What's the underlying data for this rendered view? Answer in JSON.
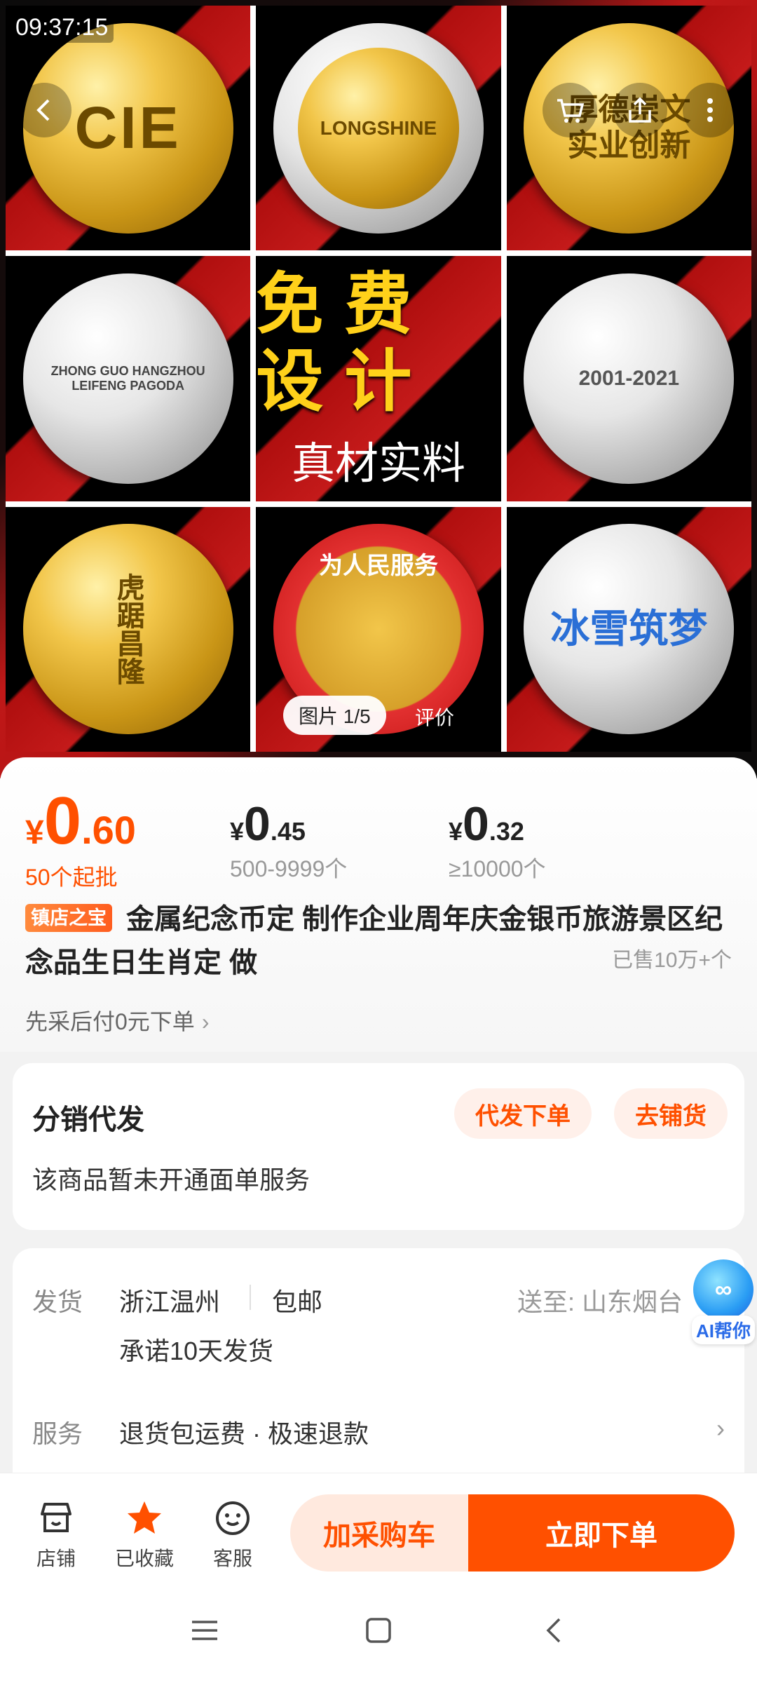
{
  "status_bar": {
    "time": "09:37:15"
  },
  "hero": {
    "back_icon": "chevron-left-icon",
    "cart_icon": "cart-icon",
    "share_icon": "share-icon",
    "more_icon": "more-dots-icon",
    "cells": [
      {
        "style": "gold",
        "text": "CIE"
      },
      {
        "style": "silver",
        "text": "LONGSHINE"
      },
      {
        "style": "gold",
        "text": "厚德崇文\n实业创新"
      },
      {
        "style": "silver",
        "text": "ZHONG GUO HANGZHOU LEIFENG PAGODA"
      },
      {
        "style": "center",
        "big": "免费设计",
        "sub": "真材实料"
      },
      {
        "style": "silver",
        "text": "2001-2021"
      },
      {
        "style": "gold",
        "text": "虎踞昌隆"
      },
      {
        "style": "red",
        "text": "为人民服务"
      },
      {
        "style": "silver",
        "text": "冰雪筑梦"
      }
    ],
    "image_index": "图片 1/5",
    "review_label": "评价"
  },
  "pricing": {
    "tiers": [
      {
        "currency": "¥",
        "int": "0",
        "dec": ".60",
        "qty": "50个起批"
      },
      {
        "currency": "¥",
        "int": "0",
        "dec": ".45",
        "qty": "500-9999个"
      },
      {
        "currency": "¥",
        "int": "0",
        "dec": ".32",
        "qty": "≥10000个"
      }
    ]
  },
  "product": {
    "badge": "镇店之宝",
    "title": "金属纪念币定 制作企业周年庆金银币旅游景区纪念品生日生肖定 做",
    "sold": "已售10万+个",
    "paylater": "先采后付0元下单"
  },
  "distribution": {
    "title": "分销代发",
    "btn_dropship": "代发下单",
    "btn_stock": "去铺货",
    "note": "该商品暂未开通面单服务"
  },
  "shipping": {
    "ship_label": "发货",
    "origin": "浙江温州",
    "free_ship": "包邮",
    "deliver_to": "送至: 山东烟台",
    "promise": "承诺10天发货",
    "service_label": "服务",
    "service_value": "退货包运费 · 极速退款"
  },
  "ai_helper": {
    "label": "AI帮你"
  },
  "action_bar": {
    "shop": "店铺",
    "favorited": "已收藏",
    "service": "客服",
    "add_cart": "加采购车",
    "buy_now": "立即下单"
  },
  "colors": {
    "accent": "#ff5000",
    "accent_light": "#ffe9de"
  }
}
